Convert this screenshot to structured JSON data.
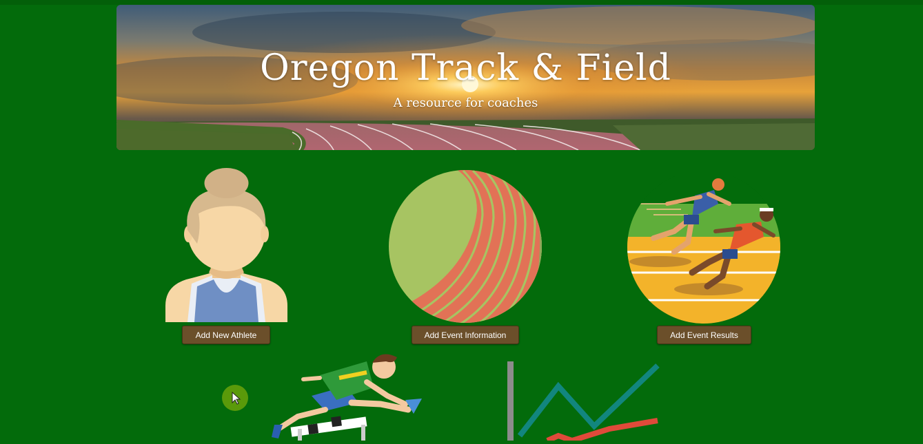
{
  "hero": {
    "title": "Oregon Track & Field",
    "subtitle": "A resource for coaches"
  },
  "cards": [
    {
      "image": "athlete-avatar-icon",
      "button_label": "Add New Athlete"
    },
    {
      "image": "running-track-icon",
      "button_label": "Add Event Information"
    },
    {
      "image": "sprinters-icon",
      "button_label": "Add Event Results"
    }
  ],
  "lower_images": [
    "hurdler-icon",
    "line-chart-icon"
  ],
  "colors": {
    "page_background": "#036b0b",
    "button_background": "#6b4f2a",
    "button_text": "#ffffff"
  }
}
